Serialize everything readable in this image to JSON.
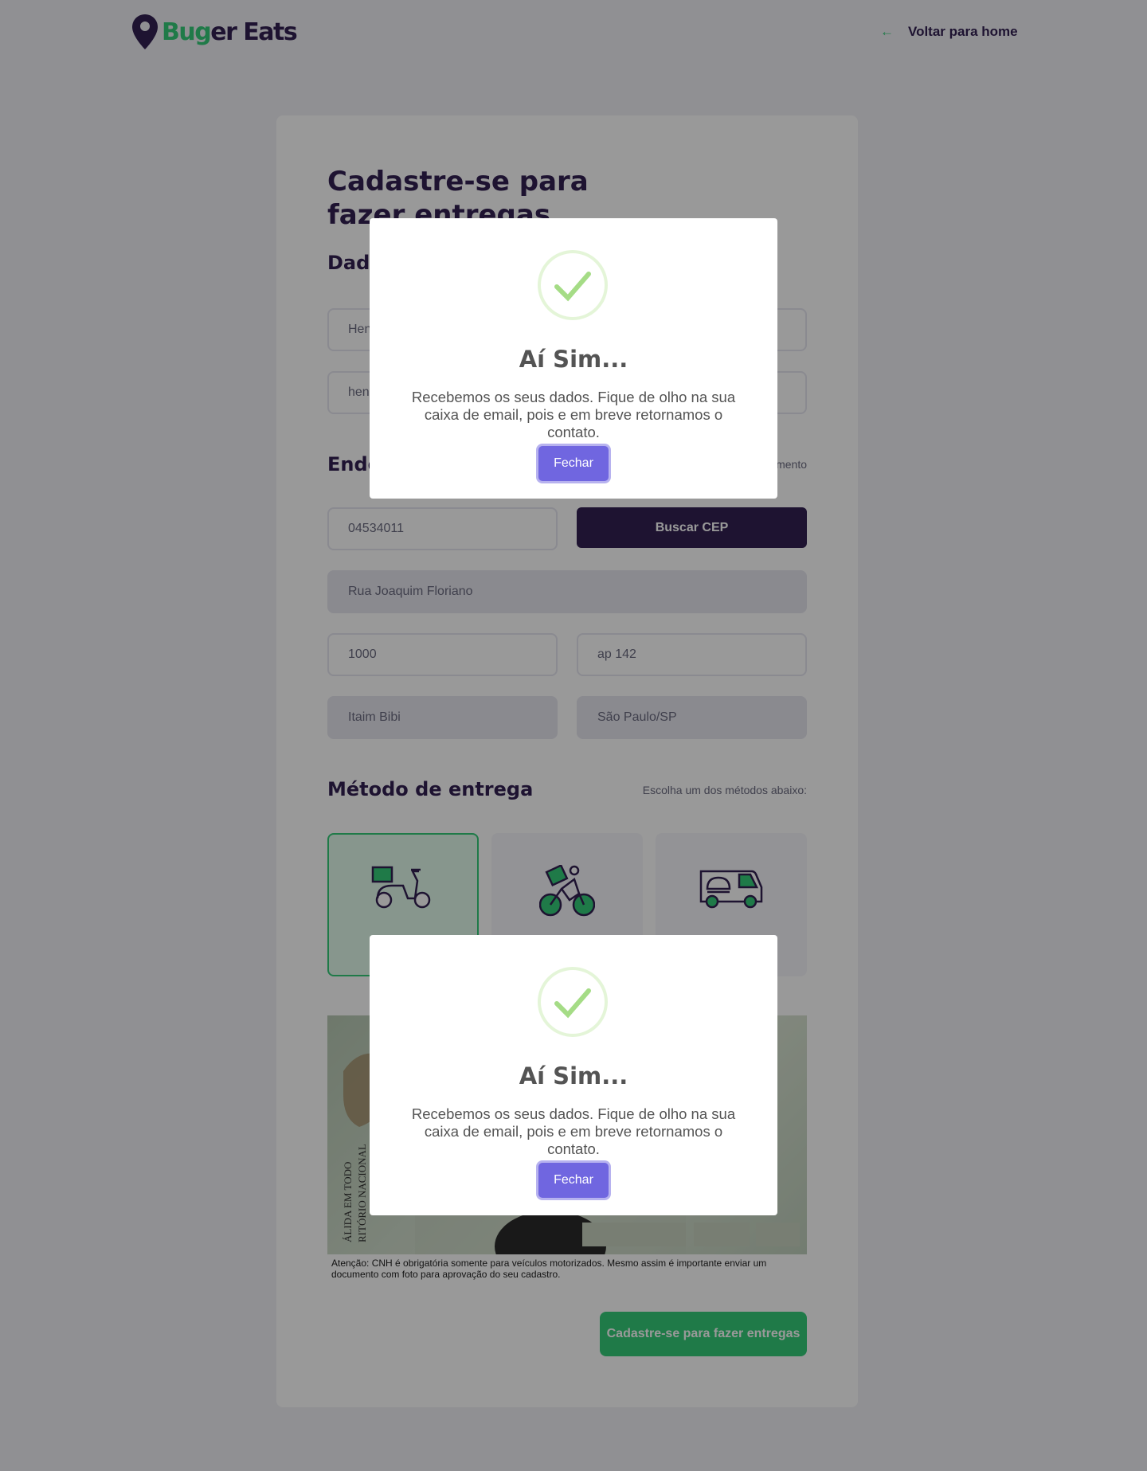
{
  "header": {
    "logo_text_1": "Bu",
    "logo_text_2": "g",
    "logo_text_3": "er Eats",
    "back_label": "Voltar para home"
  },
  "form": {
    "title": "Cadastre-se para fazer entregas",
    "personal_section": "Dados",
    "name_value": "Hen",
    "email_value": "hen",
    "address_section": "Endereço",
    "address_hint": "mento",
    "cep_value": "04534011",
    "cep_button": "Buscar CEP",
    "street_value": "Rua Joaquim Floriano",
    "number_value": "1000",
    "complement_value": "ap 142",
    "district_value": "Itaim Bibi",
    "city_value": "São Paulo/SP",
    "delivery_section": "Método de entrega",
    "delivery_hint": "Escolha um dos métodos abaixo:",
    "methods": [
      {
        "icon": "scooter-icon",
        "selected": true
      },
      {
        "icon": "bike-icon",
        "selected": false
      },
      {
        "icon": "van-icon",
        "selected": false
      }
    ],
    "doc_note": "Atenção: CNH é obrigatória somente para veículos motorizados. Mesmo assim é importante enviar um documento com foto para aprovação do seu cadastro.",
    "submit_button": "Cadastre-se para fazer entregas"
  },
  "modals": [
    {
      "title": "Aí Sim...",
      "text": "Recebemos os seus dados. Fique de olho na sua caixa de email, pois e em breve retornamos o contato.",
      "button": "Fechar"
    },
    {
      "title": "Aí Sim...",
      "text": "Recebemos os seus dados. Fique de olho na sua caixa de email, pois e em breve retornamos o contato.",
      "button": "Fechar"
    }
  ],
  "colors": {
    "brand_purple": "#322153",
    "brand_green": "#34cb79",
    "modal_button": "#7066e0",
    "success_check": "#a5dc86"
  }
}
